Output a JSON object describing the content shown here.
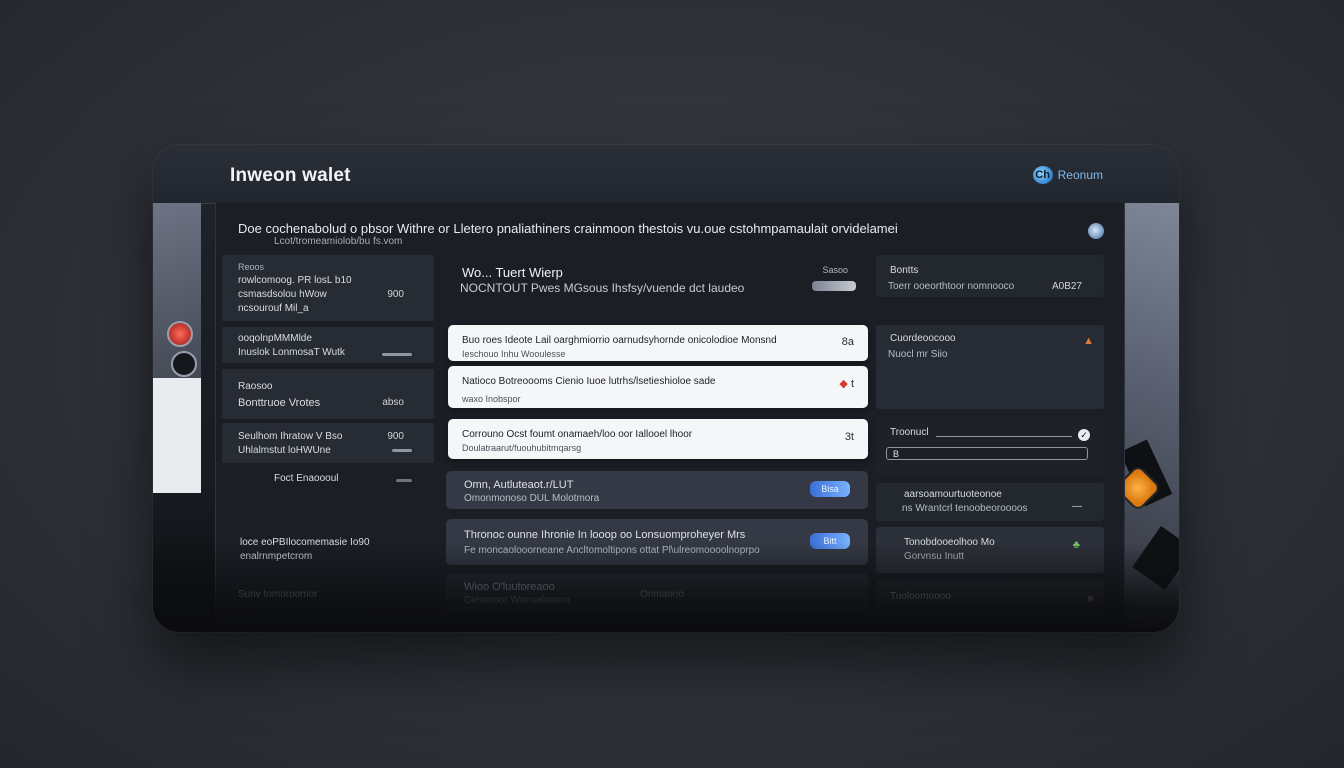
{
  "app": {
    "title": "Inweon walet",
    "brand_label": "Reonum",
    "brand_glyph": "Ch"
  },
  "header": {
    "headline": "Doe cochenabolud o pbsor Withre or Lletero pnaliathiners crainmoon thestois vu.oue cstohmpamaulait orvidelamei",
    "subline": "Lcot/tromeamiolob/bu fs.vom"
  },
  "left_panel": {
    "items": [
      {
        "title": "Reoos",
        "line1": "rowlcomoog. PR losL b10",
        "line2": "csmasdsolou hWow",
        "line3": "ncsourouf Mil_a",
        "value": "900"
      },
      {
        "title": "ooqolnpMMMlde",
        "line1": "Inuslok LonmosaT Wutk",
        "value": ""
      },
      {
        "title": "Raosoo",
        "line1": "Bonttruoe Vrotes",
        "value": "abso"
      },
      {
        "title": "Seulhom Ihratow V Bso",
        "line1": "Uhlalmstut loHWUne",
        "value": "900"
      },
      {
        "title": "Foct Enaoooul",
        "value": ""
      },
      {
        "title": "loce eoPBIlocomemasie Io90",
        "line1": "enalrnmpetcrom"
      },
      {
        "title": "Sunv tomoroomor"
      }
    ]
  },
  "center_panel": {
    "hero_title": "Wo... Tuert Wierp",
    "hero_sub": "NOCNTOUT Pwes MGsous Ihsfsy/vuende dct laudeo",
    "hero_meta": "Sasoo",
    "cards": [
      {
        "line1": "Buo roes Ideote Lail oarghmiorrio oarnudsyhornde onicolodioe Monsnd",
        "line2": "Ieschouo Inhu Wooulesse",
        "action": "8a"
      },
      {
        "line1": "Natioco Botreoooms Cienio Iuoe lutrhs/lsetieshioloe sade",
        "line2": "waxo Inobspor",
        "action": "t"
      },
      {
        "line1": "Corrouno Ocst foumt onamaeh/loo oor Iallooel lhoor",
        "line2": "Doulatraarut/fuouhubitmqarsg",
        "action": "3t"
      }
    ],
    "dark_cards": [
      {
        "line1": "Omn, Autluteaot.r/LUT",
        "line2": "Omonmonoso DUL Molotmora",
        "chip": "Bisa"
      },
      {
        "line1": "Thronoc ounne Ihronie In looop oo Lonsuomproheyer Mrs",
        "line2": "Fe moncaolooorneane Ancltomoltipons ottat Pl\\ulreomoooolnoprpo",
        "chip": "Bitt"
      },
      {
        "line1": "Wioo O'luutoreaoo",
        "line2": "Gieomoor Wonsaloooro",
        "extra": "Onmaono"
      }
    ]
  },
  "right_panel": {
    "cards": [
      {
        "title": "Bontts",
        "line1": "Toerr ooeorthtoor nomnooco",
        "value": "A0B27"
      },
      {
        "title": "Cuordeoocooo",
        "line1": "Nuocl mr Siio"
      },
      {
        "title": "Troonucl",
        "field_value": "B",
        "dropdown_value": ""
      },
      {
        "title": "aarsoamourtuoteonoe",
        "line1": "ns Wrantcrl tenoobeoroooos"
      },
      {
        "title": "Tonobdooeolhoo Mo",
        "line1": "Gorvnsu Inutt"
      },
      {
        "title": "Tuoloomoooo"
      }
    ]
  },
  "colors": {
    "accent_blue": "#3a6fd8",
    "accent_orange": "#e07a38",
    "accent_green": "#79c46a"
  }
}
